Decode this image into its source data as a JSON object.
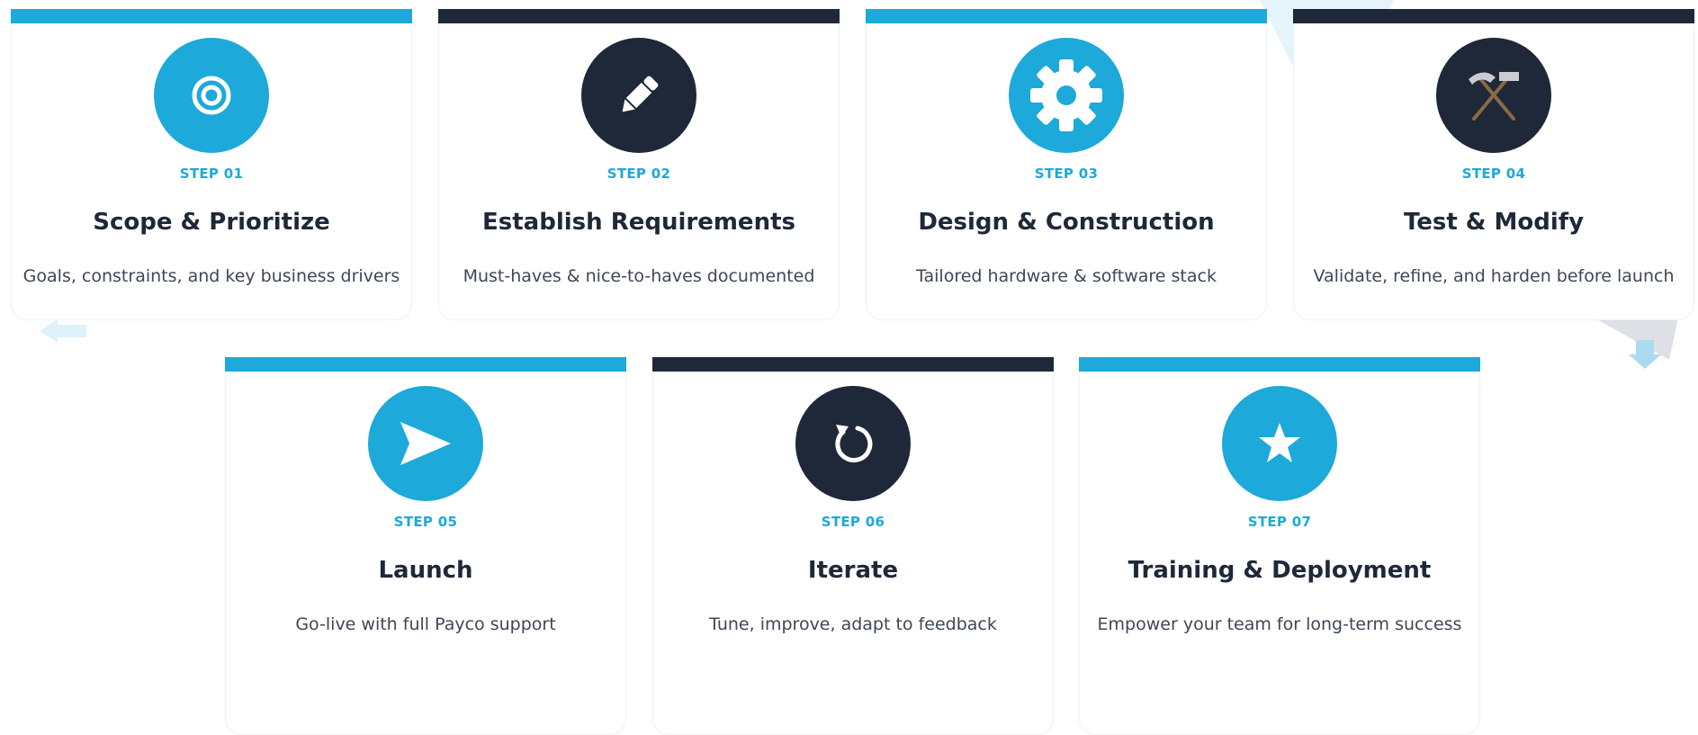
{
  "colors": {
    "accent": "#1da9d9",
    "dark": "#1f2838",
    "muted_text": "#3e4756"
  },
  "steps": [
    {
      "step": "STEP 01",
      "title": "Scope & Prioritize",
      "desc": "Goals, constraints, and key business drivers",
      "icon": "target-icon",
      "theme": "accent"
    },
    {
      "step": "STEP 02",
      "title": "Establish Requirements",
      "desc": "Must-haves & nice-to-haves documented",
      "icon": "pencil-icon",
      "theme": "dark"
    },
    {
      "step": "STEP 03",
      "title": "Design & Construction",
      "desc": "Tailored hardware & software stack",
      "icon": "gear-icon",
      "theme": "accent"
    },
    {
      "step": "STEP 04",
      "title": "Test & Modify",
      "desc": "Validate, refine, and harden before launch",
      "icon": "hammer-pick-icon",
      "theme": "dark"
    },
    {
      "step": "STEP 05",
      "title": "Launch",
      "desc": "Go-live with full Payco support",
      "icon": "send-icon",
      "theme": "accent"
    },
    {
      "step": "STEP 06",
      "title": "Iterate",
      "desc": "Tune, improve, adapt to feedback",
      "icon": "refresh-icon",
      "theme": "dark"
    },
    {
      "step": "STEP 07",
      "title": "Training & Deployment",
      "desc": "Empower your team for long-term success",
      "icon": "star-icon",
      "theme": "accent"
    }
  ]
}
